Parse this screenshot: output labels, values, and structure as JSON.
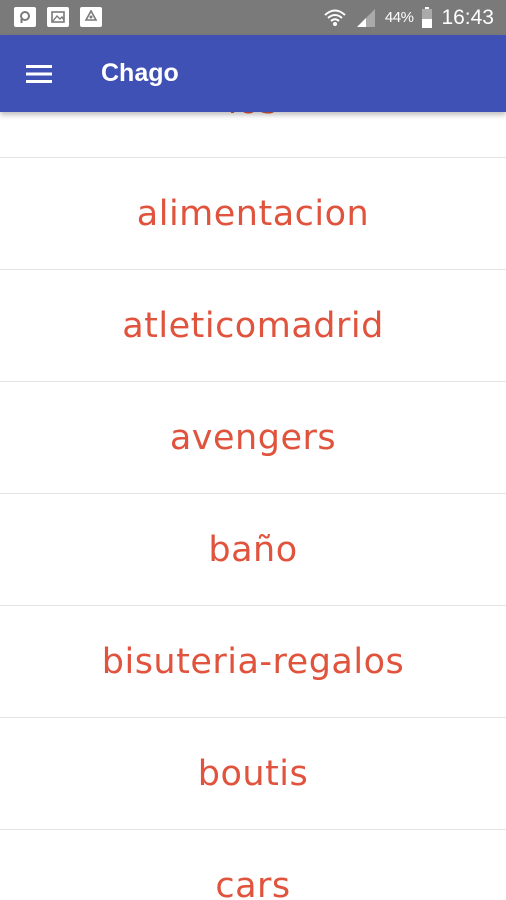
{
  "status_bar": {
    "left_icons": [
      "notification-icon-1",
      "image-notification-icon",
      "recycle-notification-icon"
    ],
    "right_icons": [
      "wifi-icon",
      "signal-icon",
      "battery-icon"
    ],
    "battery_percent": "44%",
    "time": "16:43"
  },
  "app_bar": {
    "menu_icon": "hamburger-menu-icon",
    "title": "Chago",
    "color": "#3f51b5"
  },
  "categories": {
    "text_color": "#e0533c",
    "items": [
      "ios",
      "alimentacion",
      "atleticomadrid",
      "avengers",
      "baño",
      "bisuteria-regalos",
      "boutis",
      "cars"
    ]
  }
}
